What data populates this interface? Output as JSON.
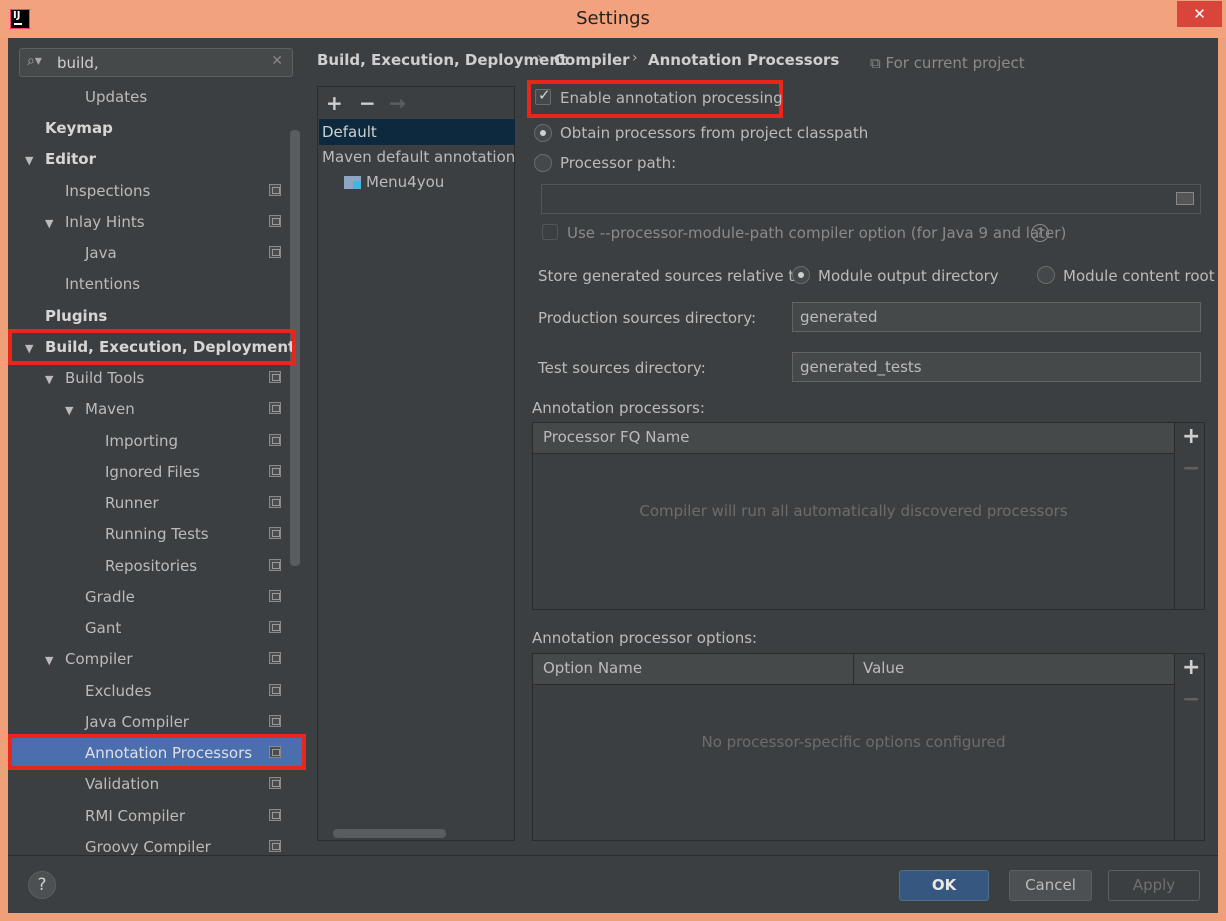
{
  "window": {
    "title": "Settings",
    "app_icon": "intellij-icon",
    "close_glyph": "✕"
  },
  "search": {
    "value": "build,",
    "icon": "search-icon",
    "clear": "✕"
  },
  "sidebar": {
    "items": [
      {
        "label": "Updates"
      },
      {
        "label": "Keymap"
      },
      {
        "label": "Editor"
      },
      {
        "label": "Inspections"
      },
      {
        "label": "Inlay Hints"
      },
      {
        "label": "Java"
      },
      {
        "label": "Intentions"
      },
      {
        "label": "Plugins"
      },
      {
        "label": "Build, Execution, Deployment"
      },
      {
        "label": "Build Tools"
      },
      {
        "label": "Maven"
      },
      {
        "label": "Importing"
      },
      {
        "label": "Ignored Files"
      },
      {
        "label": "Runner"
      },
      {
        "label": "Running Tests"
      },
      {
        "label": "Repositories"
      },
      {
        "label": "Gradle"
      },
      {
        "label": "Gant"
      },
      {
        "label": "Compiler"
      },
      {
        "label": "Excludes"
      },
      {
        "label": "Java Compiler"
      },
      {
        "label": "Annotation Processors"
      },
      {
        "label": "Validation"
      },
      {
        "label": "RMI Compiler"
      },
      {
        "label": "Groovy Compiler"
      }
    ],
    "selected": "Annotation Processors"
  },
  "breadcrumb": {
    "items": [
      "Build, Execution, Deployment",
      "Compiler",
      "Annotation Processors"
    ],
    "separator": "›",
    "scope_note": "For current project"
  },
  "profiles": {
    "toolbar": {
      "add": "+",
      "remove": "−",
      "move": "→"
    },
    "items": [
      {
        "label": "Default"
      },
      {
        "label": "Maven default annotation p"
      },
      {
        "label": "Menu4you"
      }
    ],
    "selected": "Default"
  },
  "settings": {
    "enable_label": "Enable annotation processing",
    "enable_checked": true,
    "obtain_label": "Obtain processors from project classpath",
    "processor_path_label": "Processor path:",
    "processor_path_value": "",
    "module_path_label": "Use --processor-module-path compiler option (for Java 9 and later)",
    "help_glyph": "?",
    "store_label": "Store generated sources relative to:",
    "module_output_label": "Module output directory",
    "module_content_label": "Module content root",
    "prod_dir_label": "Production sources directory:",
    "prod_dir_value": "generated",
    "test_dir_label": "Test sources directory:",
    "test_dir_value": "generated_tests"
  },
  "processors_table": {
    "title": "Annotation processors:",
    "column": "Processor FQ Name",
    "empty_text": "Compiler will run all automatically discovered processors",
    "add": "+",
    "remove": "−"
  },
  "options_table": {
    "title": "Annotation processor options:",
    "columns": [
      "Option Name",
      "Value"
    ],
    "empty_text": "No processor-specific options configured",
    "add": "+",
    "remove": "−"
  },
  "buttons": {
    "help": "?",
    "ok": "OK",
    "cancel": "Cancel",
    "apply": "Apply"
  },
  "colors": {
    "highlight": "#e8261c",
    "selection": "#4b6eaf",
    "background": "#3c3f41",
    "window_frame": "#f2a27c"
  }
}
